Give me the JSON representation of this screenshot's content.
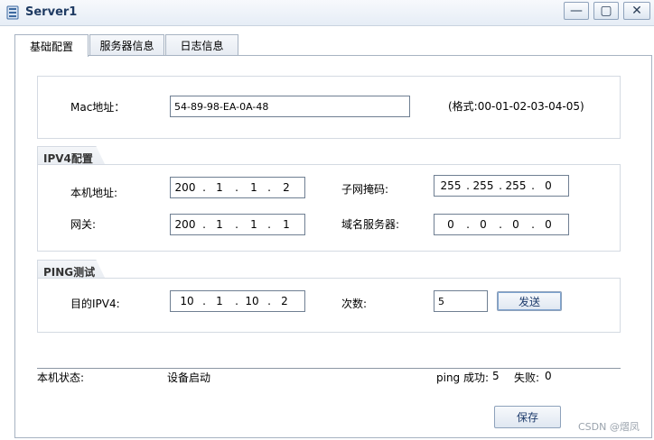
{
  "window": {
    "title": "Server1",
    "controls": {
      "minimize": "—",
      "maximize": "▢",
      "close": "✕"
    }
  },
  "tabs": [
    {
      "label": "基础配置",
      "active": true
    },
    {
      "label": "服务器信息",
      "active": false
    },
    {
      "label": "日志信息",
      "active": false
    }
  ],
  "mac": {
    "label": "Mac地址：",
    "value": "54-89-98-EA-0A-48",
    "format_hint": "(格式:00-01-02-03-04-05)"
  },
  "ipv4": {
    "group_title": "IPV4配置",
    "local_ip": {
      "label": "本机地址:",
      "octets": [
        "200",
        "1",
        "1",
        "2"
      ]
    },
    "subnet_mask": {
      "label": "子网掩码:",
      "octets": [
        "255",
        "255",
        "255",
        "0"
      ]
    },
    "gateway": {
      "label": "网关:",
      "octets": [
        "200",
        "1",
        "1",
        "1"
      ]
    },
    "dns": {
      "label": "域名服务器:",
      "octets": [
        "0",
        "0",
        "0",
        "0"
      ]
    }
  },
  "ping": {
    "group_title": "PING测试",
    "target": {
      "label": "目的IPV4:",
      "octets": [
        "10",
        "1",
        "10",
        "2"
      ]
    },
    "count_label": "次数:",
    "count_value": "5",
    "send_label": "发送"
  },
  "status": {
    "label": "本机状态:",
    "value": "设备启动",
    "ping_success_label": "ping 成功:",
    "ping_success_value": "5",
    "fail_label": "失败:",
    "fail_value": "0"
  },
  "save_label": "保存",
  "watermark": "CSDN @熠凤"
}
